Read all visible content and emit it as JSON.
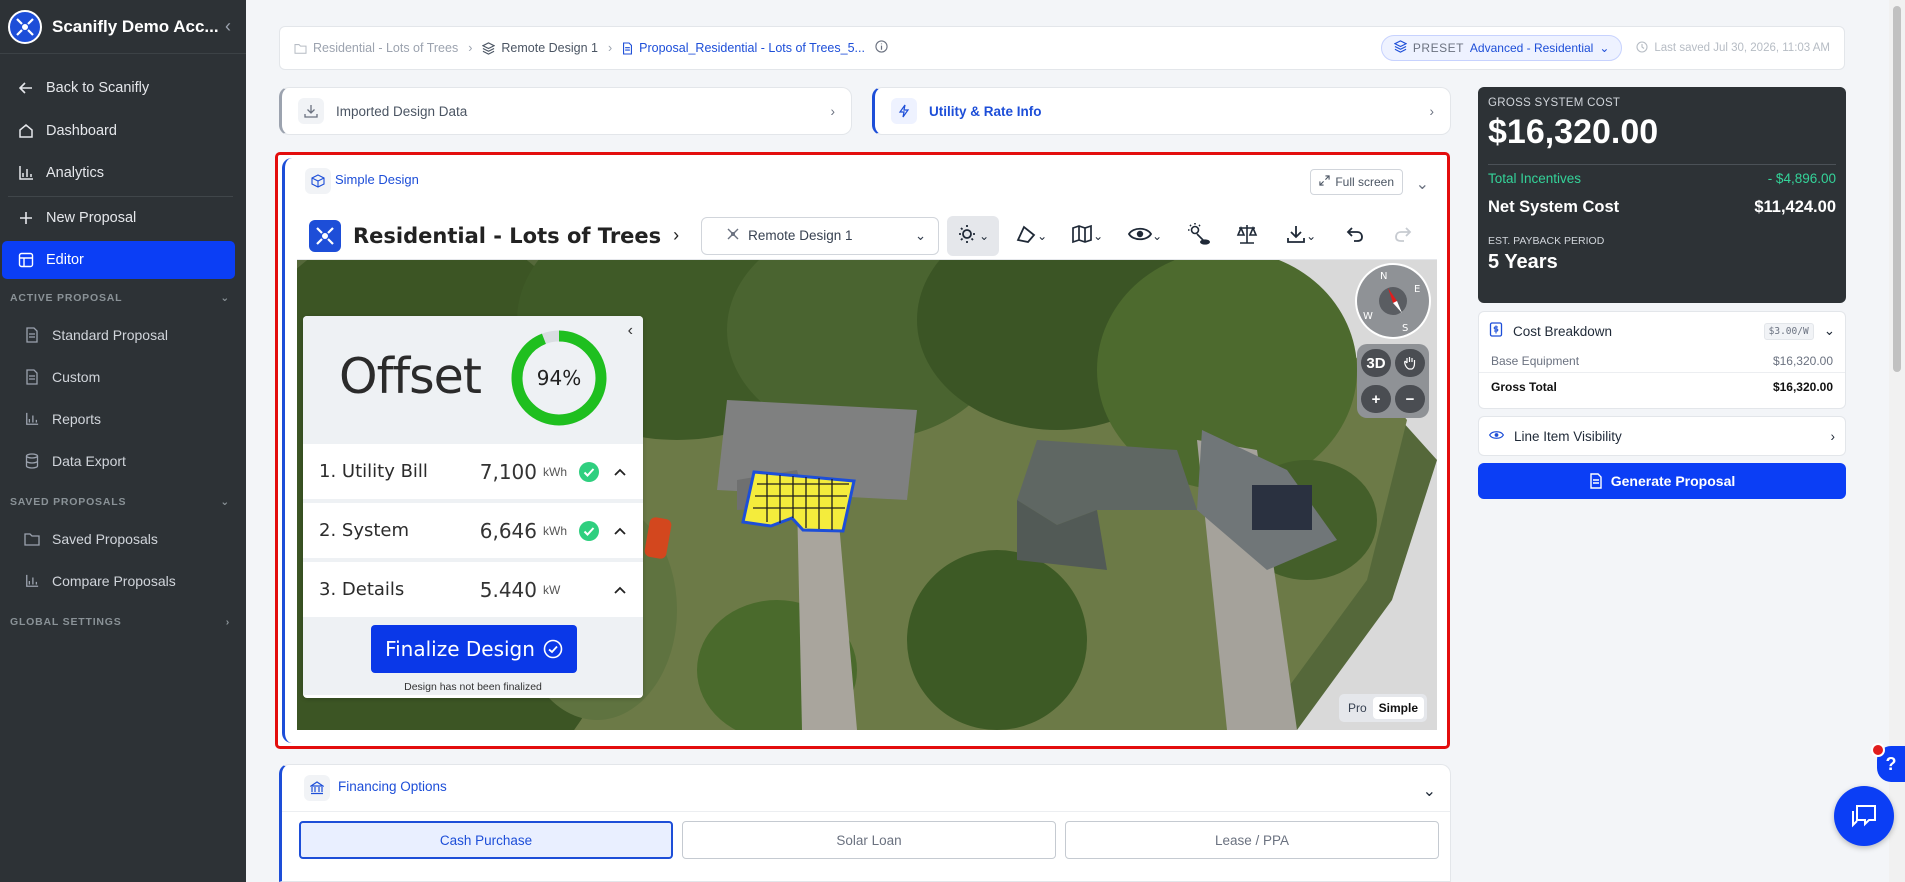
{
  "sidebar": {
    "org_name": "Scanifly Demo Acc...",
    "items": [
      {
        "label": "Back to Scanifly"
      },
      {
        "label": "Dashboard"
      },
      {
        "label": "Analytics"
      },
      {
        "label": "New Proposal"
      },
      {
        "label": "Editor"
      }
    ],
    "section_active": "ACTIVE PROPOSAL",
    "active_items": [
      {
        "label": "Standard Proposal"
      },
      {
        "label": "Custom"
      },
      {
        "label": "Reports"
      },
      {
        "label": "Data Export"
      }
    ],
    "section_saved": "SAVED PROPOSALS",
    "saved_items": [
      {
        "label": "Saved Proposals"
      },
      {
        "label": "Compare Proposals"
      }
    ],
    "section_global": "GLOBAL SETTINGS"
  },
  "breadcrumb": {
    "items": [
      "Residential - Lots of Trees",
      "Remote Design 1",
      "Proposal_Residential - Lots of Trees_5..."
    ],
    "preset_label": "PRESET",
    "preset_value": "Advanced - Residential",
    "last_saved": "Last saved Jul 30, 2026, 11:03 AM"
  },
  "panels": {
    "imported": "Imported Design Data",
    "utility": "Utility & Rate Info",
    "simple_design": "Simple Design",
    "fullscreen": "Full screen",
    "financing": "Financing Options"
  },
  "viewer": {
    "project_name": "Residential - Lots of Trees",
    "design_select": "Remote Design 1",
    "offset_label": "Offset",
    "offset_percent": "94%",
    "offset_fraction": 0.94,
    "rows": [
      {
        "label": "1. Utility Bill",
        "value": "7,100",
        "unit": "kWh",
        "check": true
      },
      {
        "label": "2. System",
        "value": "6,646",
        "unit": "kWh",
        "check": true
      },
      {
        "label": "3. Details",
        "value": "5.440",
        "unit": "kW",
        "check": false
      }
    ],
    "finalize_label": "Finalize Design",
    "finalize_note": "Design has not been finalized",
    "compass": {
      "n": "N",
      "e": "E",
      "s": "S",
      "w": "W"
    },
    "btn_3d": "3D",
    "mode_pro": "Pro",
    "mode_simple": "Simple"
  },
  "financing_tabs": [
    "Cash Purchase",
    "Solar Loan",
    "Lease / PPA"
  ],
  "cost": {
    "gross_label": "GROSS SYSTEM COST",
    "gross_value": "$16,320.00",
    "incentives_label": "Total Incentives",
    "incentives_value": "- $4,896.00",
    "net_label": "Net System Cost",
    "net_value": "$11,424.00",
    "payback_label": "EST. PAYBACK PERIOD",
    "payback_value": "5 Years"
  },
  "breakdown": {
    "title": "Cost Breakdown",
    "rate": "$3.00/W",
    "base_label": "Base Equipment",
    "base_value": "$16,320.00",
    "gross_label": "Gross Total",
    "gross_value": "$16,320.00"
  },
  "visibility_title": "Line Item Visibility",
  "generate_label": "Generate Proposal",
  "help_label": "?",
  "colors": {
    "accent": "#0b3ef5",
    "sidebar": "#2d3236",
    "highlight": "#e30d0d",
    "offset_ring": "#1fbf1f"
  }
}
